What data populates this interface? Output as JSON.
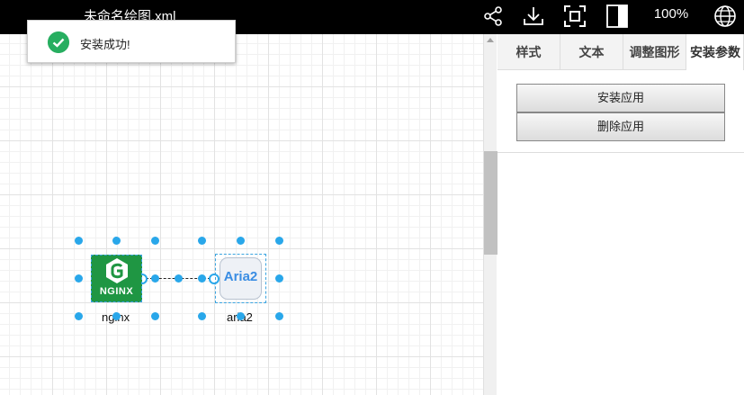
{
  "app": {
    "title": "未命名绘图.xml",
    "zoom": "100%"
  },
  "toolbar": {
    "icons": [
      "share-icon",
      "download-icon",
      "fit-icon",
      "format-panel-icon",
      "language-icon"
    ]
  },
  "toast": {
    "message": "安装成功!",
    "icon": "check-circle-icon",
    "color": "#27ae60"
  },
  "diagram": {
    "nodes": [
      {
        "id": "nginx",
        "label": "nginx",
        "logo_text": "NGINX",
        "color": "#1f9643"
      },
      {
        "id": "aria2",
        "label": "aria2",
        "logo_text": "Aria2",
        "color": "#3a8de3"
      }
    ],
    "selection_color": "#29a7ea"
  },
  "panel": {
    "tabs": [
      {
        "label": "样式"
      },
      {
        "label": "文本"
      },
      {
        "label": "调整图形"
      },
      {
        "label": "安装参数",
        "active": true
      }
    ],
    "buttons": {
      "install": "安装应用",
      "delete": "删除应用"
    }
  }
}
